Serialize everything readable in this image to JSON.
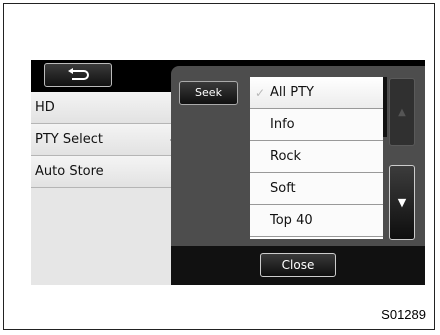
{
  "left_menu": {
    "items": [
      {
        "label": "HD"
      },
      {
        "label": "PTY Select"
      },
      {
        "label": "Auto Store"
      }
    ],
    "selected_index": 1
  },
  "popup": {
    "seek_label": "Seek",
    "list": [
      {
        "label": "All PTY",
        "checked": true
      },
      {
        "label": "Info"
      },
      {
        "label": "Rock"
      },
      {
        "label": "Soft"
      },
      {
        "label": "Top 40"
      }
    ],
    "close_label": "Close",
    "check_glyph": "✓",
    "up_arrow_glyph": "▲",
    "down_arrow_glyph": "▼",
    "back_icon": "return-arrow-icon"
  },
  "caption": "S01289",
  "colors": {
    "screen_background": "#000000",
    "menu_background": "#e6e6e6",
    "popup_background": "#4d4d4d",
    "list_background": "#fbfbfb"
  }
}
